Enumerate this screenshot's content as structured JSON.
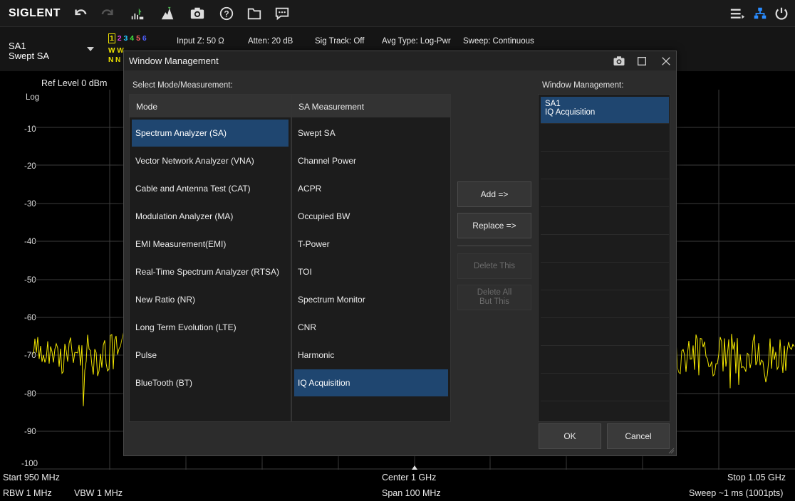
{
  "toolbar": {
    "logo": "SIGLENT",
    "icons": [
      "undo-icon",
      "redo-icon",
      "auto-tune-icon",
      "peak-search-icon",
      "camera-icon",
      "help-icon",
      "folder-icon",
      "chat-icon",
      "menu-icon",
      "network-icon",
      "power-icon"
    ]
  },
  "info": {
    "mode_line1": "SA1",
    "mode_line2": "Swept SA",
    "trace_nums": [
      "1",
      "2",
      "3",
      "4",
      "5",
      "6"
    ],
    "trace_colors": [
      "#f2e600",
      "#e040e0",
      "#20c8ff",
      "#40e040",
      "#ff6060",
      "#5060ff"
    ],
    "trace_w": "W W",
    "trace_n": "N N",
    "input_z": "Input Z: 50 Ω",
    "atten": "Atten: 20 dB",
    "sig_track": "Sig Track: Off",
    "avg_type": "Avg Type: Log-Pwr",
    "sweep": "Sweep: Continuous"
  },
  "graph": {
    "ref_level": "Ref Level  0 dBm",
    "scale": "Log",
    "y_labels": [
      "-10",
      "-20",
      "-30",
      "-40",
      "-50",
      "-60",
      "-70",
      "-80",
      "-90",
      "-100"
    ]
  },
  "footer": {
    "start": "Start  950 MHz",
    "center": "Center  1 GHz",
    "stop": "Stop  1.05 GHz",
    "rbw": "RBW  1 MHz",
    "vbw": "VBW  1 MHz",
    "span": "Span  100 MHz",
    "sweep_time": "Sweep  ~1 ms (1001pts)"
  },
  "dialog": {
    "title": "Window Management",
    "select_label": "Select Mode/Measurement:",
    "mode_header": "Mode",
    "measurement_header": "SA Measurement",
    "modes": [
      "Spectrum Analyzer (SA)",
      "Vector Network Analyzer (VNA)",
      "Cable and Antenna Test (CAT)",
      "Modulation Analyzer (MA)",
      "EMI Measurement(EMI)",
      "Real-Time Spectrum Analyzer (RTSA)",
      "New Ratio (NR)",
      "Long Term Evolution (LTE)",
      "Pulse",
      "BlueTooth (BT)"
    ],
    "measurements": [
      "Swept SA",
      "Channel Power",
      "ACPR",
      "Occupied BW",
      "T-Power",
      "TOI",
      "Spectrum Monitor",
      "CNR",
      "Harmonic",
      "IQ Acquisition"
    ],
    "add_label": "Add    =>",
    "replace_label": "Replace  =>",
    "delete_this_label": "Delete This",
    "delete_all_line1": "Delete All",
    "delete_all_line2": "But This",
    "wm_label": "Window Management:",
    "wm_item_line1": "SA1",
    "wm_item_line2": "IQ Acquisition",
    "ok_label": "OK",
    "cancel_label": "Cancel"
  }
}
